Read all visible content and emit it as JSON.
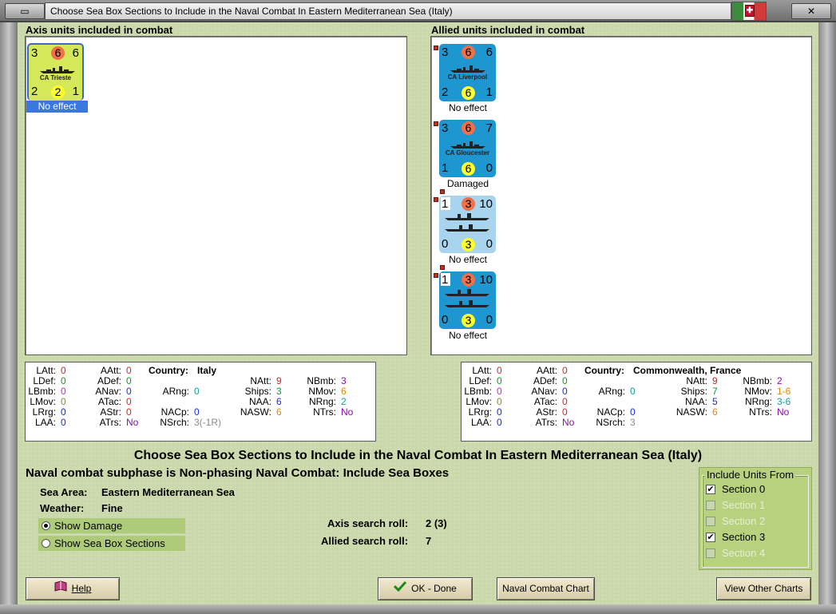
{
  "window": {
    "title": "Choose Sea Box Sections to Include in the Naval Combat In Eastern Mediterranean Sea (Italy)"
  },
  "axis": {
    "heading": "Axis units included in combat",
    "units": [
      {
        "name": "CA Trieste",
        "tl": "3",
        "tc": "6",
        "tr": "6",
        "bl": "2",
        "bc": "2",
        "br": "1",
        "status": "No effect",
        "color": "#d4e85a"
      }
    ],
    "stats": {
      "country_label": "Country:",
      "country": "Italy",
      "LAtt": "0",
      "LDef": "0",
      "LBmb": "0",
      "LMov": "0",
      "LRrg": "0",
      "LAA": "0",
      "AAtt": "0",
      "ADef": "0",
      "ANav": "0",
      "ATac": "0",
      "AStr": "0",
      "ATrs": "No",
      "ARng": "0",
      "NACp": "0",
      "NSrch": "3(-1R)",
      "NAtt": "9",
      "Ships": "3",
      "NAA": "6",
      "NASW": "6",
      "NBmb": "3",
      "NMov": "6",
      "NRng": "2",
      "NTrs": "No"
    }
  },
  "allied": {
    "heading": "Allied units included in combat",
    "units": [
      {
        "name": "CA Liverpool",
        "tl": "3",
        "tc": "6",
        "tr": "6",
        "bl": "2",
        "bc": "6",
        "br": "1",
        "status": "No effect",
        "color": "#1e96cf"
      },
      {
        "name": "CA Gloucester",
        "tl": "3",
        "tc": "6",
        "tr": "7",
        "bl": "1",
        "bc": "6",
        "br": "0",
        "status": "Damaged",
        "color": "#1e96cf"
      },
      {
        "name": "",
        "tl": "1",
        "tc": "3",
        "tr": "10",
        "bl": "0",
        "bc": "3",
        "br": "0",
        "status": "No effect",
        "color": "#a9d4ee"
      },
      {
        "name": "",
        "tl": "1",
        "tc": "3",
        "tr": "10",
        "bl": "0",
        "bc": "3",
        "br": "0",
        "status": "No effect",
        "color": "#1e96cf"
      }
    ],
    "stats": {
      "country_label": "Country:",
      "country": "Commonwealth, France",
      "LAtt": "0",
      "LDef": "0",
      "LBmb": "0",
      "LMov": "0",
      "LRrg": "0",
      "LAA": "0",
      "AAtt": "0",
      "ADef": "0",
      "ANav": "0",
      "ATac": "0",
      "AStr": "0",
      "ATrs": "No",
      "ARng": "0",
      "NACp": "0",
      "NSrch": "3",
      "NAtt": "9",
      "Ships": "7",
      "NAA": "5",
      "NASW": "6",
      "NBmb": "2",
      "NMov": "1-6",
      "NRng": "3-6",
      "NTrs": "No"
    }
  },
  "stat_labels": {
    "LAtt": "LAtt:",
    "LDef": "LDef:",
    "LBmb": "LBmb:",
    "LMov": "LMov:",
    "LRrg": "LRrg:",
    "LAA": "LAA:",
    "AAtt": "AAtt:",
    "ADef": "ADef:",
    "ANav": "ANav:",
    "ATac": "ATac:",
    "AStr": "AStr:",
    "ATrs": "ATrs:",
    "ARng": "ARng:",
    "NACp": "NACp:",
    "NSrch": "NSrch:",
    "NAtt": "NAtt:",
    "Ships": "Ships:",
    "NAA": "NAA:",
    "NASW": "NASW:",
    "NBmb": "NBmb:",
    "NMov": "NMov:",
    "NRng": "NRng:",
    "NTrs": "NTrs:"
  },
  "main": {
    "title": "Choose Sea Box Sections to Include in the Naval Combat In Eastern Mediterranean Sea (Italy)",
    "subphase": "Naval combat subphase is Non-phasing Naval Combat: Include Sea Boxes",
    "sea_area_label": "Sea Area:",
    "sea_area": "Eastern Mediterranean Sea",
    "weather_label": "Weather:",
    "weather": "Fine",
    "axis_roll_label": "Axis search roll:",
    "axis_roll": "2 (3)",
    "allied_roll_label": "Allied search roll:",
    "allied_roll": "7",
    "show_damage": "Show Damage",
    "show_sections": "Show Sea Box Sections"
  },
  "sections": {
    "title": "Include Units From",
    "items": [
      {
        "label": "Section 0",
        "checked": true,
        "enabled": true
      },
      {
        "label": "Section 1",
        "checked": false,
        "enabled": false
      },
      {
        "label": "Section 2",
        "checked": false,
        "enabled": false
      },
      {
        "label": "Section 3",
        "checked": true,
        "enabled": true
      },
      {
        "label": "Section 4",
        "checked": false,
        "enabled": false
      }
    ]
  },
  "buttons": {
    "help": "Help",
    "ok": "OK - Done",
    "naval_chart": "Naval Combat Chart",
    "other_charts": "View Other Charts"
  },
  "icons": {
    "help": "book-icon",
    "ok": "checkmark-icon"
  }
}
